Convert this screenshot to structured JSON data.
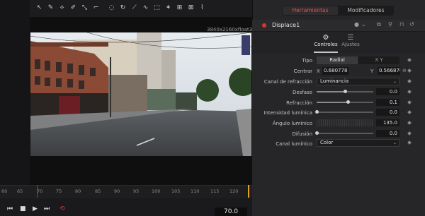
{
  "viewer": {
    "format_label": "3840x2160xfloat32"
  },
  "timeline": {
    "ticks": [
      "60",
      "65",
      "70",
      "75",
      "80",
      "85",
      "90",
      "95",
      "100",
      "105",
      "110",
      "115",
      "120"
    ],
    "timecode": "70.0"
  },
  "inspector": {
    "tabs": {
      "active": "Herramientas",
      "other": "Modificadores"
    },
    "node": {
      "title": "Displace1",
      "color": "#d33a3a"
    },
    "subtabs": {
      "active": "Controles",
      "other": "Ajustes"
    },
    "params": {
      "tipo": {
        "label": "Tipo",
        "options": [
          "Radial",
          "X Y"
        ],
        "selected": "Radial"
      },
      "centrar": {
        "label": "Centrar",
        "x_label": "X",
        "x": "0.680778",
        "y_label": "Y",
        "y": "0.566876"
      },
      "canal_refraccion": {
        "label": "Canal de refracción",
        "value": "Luminancia"
      },
      "desfase": {
        "label": "Desfase",
        "value": "0.0",
        "level": 0.5
      },
      "refraccion": {
        "label": "Refracción",
        "value": "0.1",
        "level": 0.55
      },
      "intensidad": {
        "label": "Intensidad lumínica",
        "value": "0.0",
        "level": 0.0
      },
      "angulo": {
        "label": "Ángulo lumínico",
        "value": "135.0"
      },
      "difusion": {
        "label": "Difusión",
        "value": "0.0",
        "level": 0.0
      },
      "canal_luminico": {
        "label": "Canal lumínico",
        "value": "Color"
      }
    }
  },
  "colors": {
    "accent": "#e05050",
    "playhead": "#c62828",
    "in_out_marker": "#e0a020"
  }
}
